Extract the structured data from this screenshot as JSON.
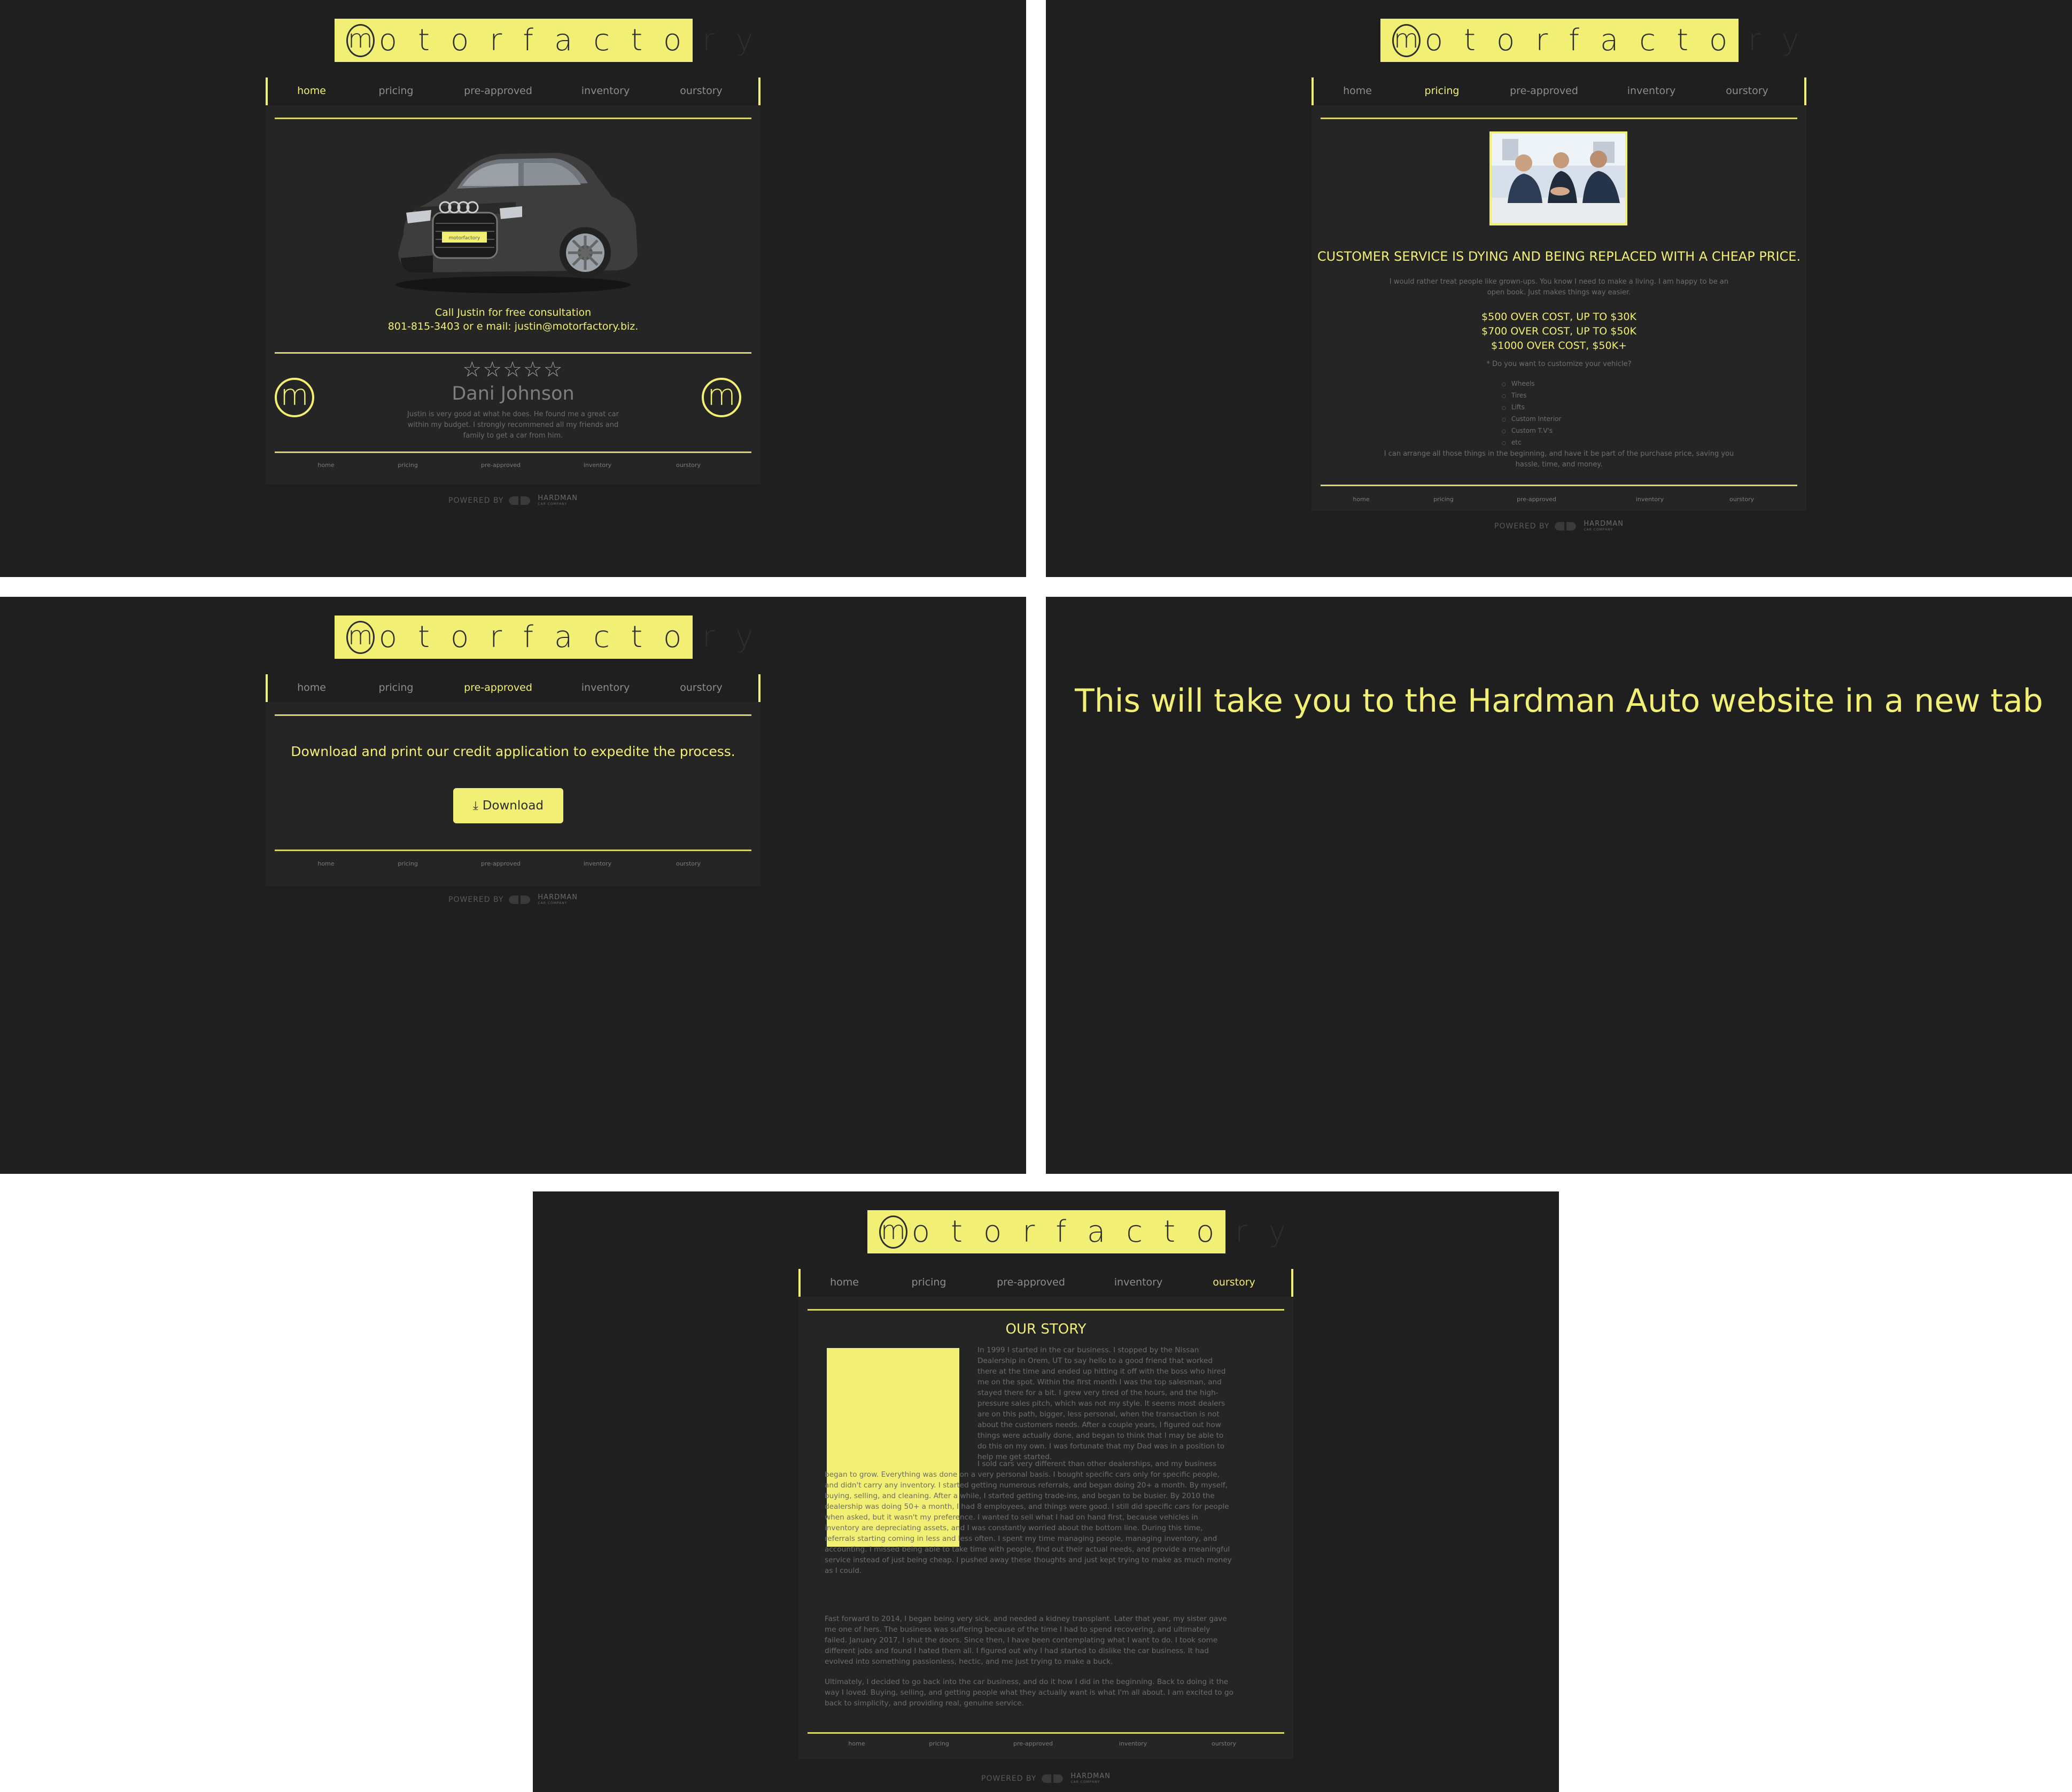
{
  "brand": {
    "logo_m": "m",
    "logo_rest": "otorfactory",
    "accent": "#f2f074",
    "background": "#1f1f1f"
  },
  "nav": {
    "home": "home",
    "pricing": "pricing",
    "preapproved": "pre-approved",
    "inventory": "inventory",
    "ourstory": "ourstory"
  },
  "powered": {
    "label": "POWERED BY",
    "brand": "HARDMAN",
    "sub": "CAR COMPANY"
  },
  "home": {
    "active_tab": "home",
    "plate": "motorfactory",
    "cta_line1": "Call Justin for free consultation",
    "cta_line2": "801-815-3403 or e mail: justin@motorfactory.biz.",
    "stars": "☆☆☆☆☆",
    "rating_out_of": 5,
    "reviewer": "Dani Johnson",
    "review": "Justin is very good at what he does. He found me a great car within my budget. I strongly recommened all my friends and family to get a car from him.",
    "badge_letter": "m"
  },
  "pricing": {
    "active_tab": "pricing",
    "headline": "CUSTOMER SERVICE IS DYING AND BEING REPLACED WITH A CHEAP PRICE.",
    "intro": "I would rather treat people like grown-ups. You know I need to make a living. I am happy to be an open book. Just makes things way easier.",
    "prices": [
      "$500 OVER COST, UP TO $30K",
      "$700 OVER COST, UP TO $50K",
      "$1000 OVER COST, $50K+"
    ],
    "custom_q": "* Do you want to customize your vehicle?",
    "custom_items": [
      "Wheels",
      "Tires",
      "Lifts",
      "Custom Interior",
      "Custom T.V's",
      "etc"
    ],
    "outro": "I can arrange all those things in the beginning, and have it be part of the purchase price, saving you hassle, time, and money."
  },
  "preapproved": {
    "active_tab": "pre-approved",
    "message": "Download and print our credit application to expedite the process.",
    "download_label": "Download"
  },
  "redirect": {
    "message": "This will take you to the Hardman Auto website in a new tab"
  },
  "ourstory": {
    "active_tab": "ourstory",
    "title": "OUR STORY",
    "p1": "In 1999 I started in the car business. I stopped by the Nissan Dealership in Orem, UT to say hello to a good friend that worked there at the time and ended up hitting it off with the boss who hired me on the spot. Within the first month I was the top salesman, and stayed there for a bit. I grew very tired of the hours, and the high-pressure sales pitch, which was not my style. It seems most dealers are on this path, bigger, less personal, when the transaction is not about the customers needs. After a couple years, I figured out how things were actually done, and began to think that I may be able to do this on my own. I was fortunate that my Dad was in a position to help me get started.",
    "p2": "I sold cars very different than other dealerships, and my business began to grow. Everything was done on a very personal basis. I bought specific cars only for specific people, and didn't carry any inventory. I started getting numerous referrals, and began doing 20+ a month. By myself, buying, selling, and cleaning. After a while, I started getting trade-ins, and began to be busier. By 2010 the dealership was doing 50+ a month, I had 8 employees, and things were good. I still did specific cars for people when asked, but it wasn't my preference. I wanted to sell what I had on hand first, because vehicles in inventory are depreciating assets, and I was constantly worried about the bottom line. During this time, referrals starting coming in less and less often. I spent my time managing people, managing inventory, and accounting. I missed being able to take time with people, find out their actual needs, and provide a meaningful service instead of just being cheap. I pushed away these thoughts and just kept trying to make as much money as I could.",
    "p3": "Fast forward to 2014, I began being very sick, and needed a kidney transplant. Later that year, my sister gave me one of hers. The business was suffering because of the time I had to spend recovering, and ultimately failed. January 2017, I shut the doors. Since then, I have been contemplating what I want to do. I took some different jobs and found I hated them all. I figured out why I had started to dislike the car business. It had evolved into something passionless, hectic, and me just trying to make a buck.",
    "p4": "Ultimately, I decided to go back into the car business, and do it how I did in the beginning. Back to doing it the way I loved. Buying, selling, and getting people what they actually want is what I'm all about. I am excited to go back to simplicity, and providing real, genuine service."
  }
}
